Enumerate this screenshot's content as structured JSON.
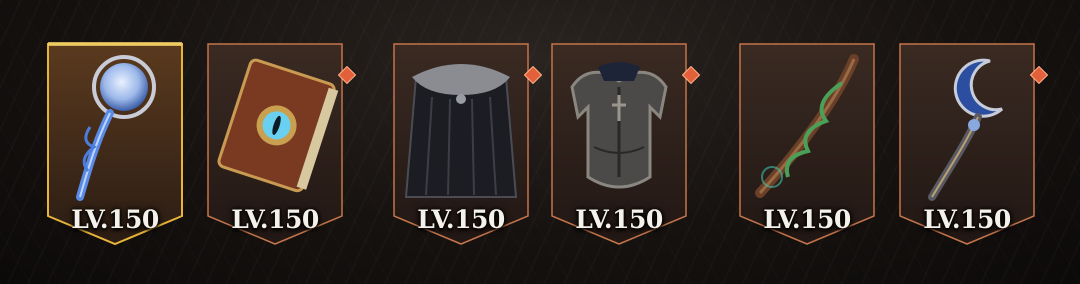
{
  "colors": {
    "frame_border": "#c4744a",
    "frame_fill_top": "#3a2a22",
    "frame_fill_bottom": "#241a16",
    "legendary_glow": "#e8b43a",
    "badge": "#e2613a"
  },
  "items": [
    {
      "name": "moon-orb-staff",
      "level": "LV.150",
      "rarity": "legendary",
      "new_badge": false
    },
    {
      "name": "eye-tome",
      "level": "LV.150",
      "rarity": "epic",
      "new_badge": true
    },
    {
      "name": "fur-cloak",
      "level": "LV.150",
      "rarity": "epic",
      "new_badge": true
    },
    {
      "name": "plate-chest-armor",
      "level": "LV.150",
      "rarity": "epic",
      "new_badge": true
    },
    {
      "name": "vine-wand",
      "level": "LV.150",
      "rarity": "epic",
      "new_badge": false
    },
    {
      "name": "crescent-moon-staff",
      "level": "LV.150",
      "rarity": "epic",
      "new_badge": true
    }
  ]
}
